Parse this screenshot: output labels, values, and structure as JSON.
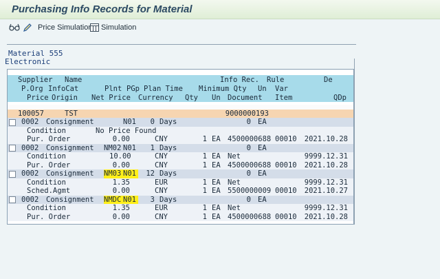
{
  "window": {
    "title": "Purchasing Info Records for Material"
  },
  "toolbar": {
    "price_simulation": "Price Simulation",
    "simulation": "Simulation"
  },
  "material": {
    "line": "Material 555",
    "description": "Electronic"
  },
  "colors": {
    "supplier_row": "#f6d5b1",
    "consignment_row": "#d4dde9",
    "header": "#a7dbea",
    "highlight": "#ffef1a"
  },
  "headers": {
    "r1": [
      "Supplier",
      "Name",
      "Info Rec.",
      "Rule",
      "De"
    ],
    "r2": [
      "P.Org",
      "InfoCat",
      "Plnt",
      "PGp",
      "Plan Time",
      "Minimum Qty",
      "Un",
      "Var"
    ],
    "r3": [
      "Price",
      "Origin",
      "Net Price",
      "Currency",
      "Qty",
      "Un",
      "Document",
      "Item",
      "QDp"
    ]
  },
  "rows": [
    {
      "type": "sup",
      "cells": [
        "100057",
        "TST",
        "9000000193"
      ]
    },
    {
      "type": "cons",
      "cells": [
        "0002",
        "Consignment",
        "",
        "N01",
        "0",
        "Days",
        "0",
        "EA"
      ]
    },
    {
      "type": "det",
      "cells": [
        "Condition",
        "No Price Found",
        "",
        "",
        "",
        "",
        "",
        "",
        "",
        ""
      ]
    },
    {
      "type": "det",
      "cells": [
        "Pur. Order",
        "",
        "0.00",
        "CNY",
        "1",
        "EA",
        "4500000688",
        "00010",
        "2021.10.28"
      ]
    },
    {
      "type": "cons",
      "cells": [
        "0002",
        "Consignment",
        "NM02",
        "N01",
        "1",
        "Days",
        "0",
        "EA"
      ]
    },
    {
      "type": "det",
      "cells": [
        "Condition",
        "",
        "10.00",
        "CNY",
        "1",
        "EA",
        "Net",
        "",
        "9999.12.31"
      ]
    },
    {
      "type": "det",
      "cells": [
        "Pur. Order",
        "",
        "0.00",
        "CNY",
        "1",
        "EA",
        "4500000688",
        "00010",
        "2021.10.28"
      ]
    },
    {
      "type": "cons",
      "hl": true,
      "cells": [
        "0002",
        "Consignment",
        "NM03",
        "N01",
        "12",
        "Days",
        "0",
        "EA"
      ]
    },
    {
      "type": "det",
      "cells": [
        "Condition",
        "",
        "1.35",
        "EUR",
        "1",
        "EA",
        "Net",
        "",
        "9999.12.31"
      ]
    },
    {
      "type": "det",
      "cells": [
        "Sched.Agmt",
        "",
        "0.00",
        "CNY",
        "1",
        "EA",
        "5500000009",
        "00010",
        "2021.10.27"
      ]
    },
    {
      "type": "cons",
      "hl": true,
      "cells": [
        "0002",
        "Consignment",
        "NMDC",
        "N01",
        "3",
        "Days",
        "0",
        "EA"
      ]
    },
    {
      "type": "det",
      "cells": [
        "Condition",
        "",
        "1.35",
        "EUR",
        "1",
        "EA",
        "Net",
        "",
        "9999.12.31"
      ]
    },
    {
      "type": "det",
      "cells": [
        "Pur. Order",
        "",
        "0.00",
        "CNY",
        "1",
        "EA",
        "4500000688",
        "00010",
        "2021.10.28"
      ]
    }
  ]
}
